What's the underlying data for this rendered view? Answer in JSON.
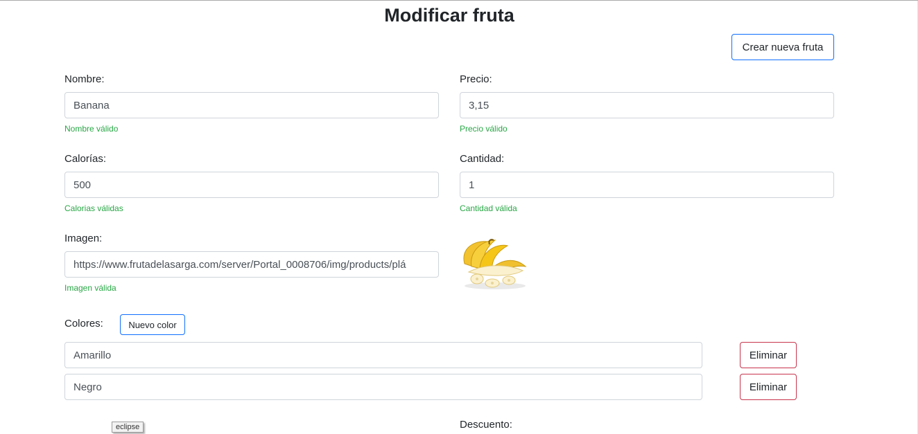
{
  "page": {
    "title": "Modificar fruta"
  },
  "toolbar": {
    "create_label": "Crear nueva fruta"
  },
  "form": {
    "nombre": {
      "label": "Nombre:",
      "value": "Banana",
      "feedback": "Nombre válido"
    },
    "precio": {
      "label": "Precio:",
      "value": "3,15",
      "feedback": "Precio válido"
    },
    "calorias": {
      "label": "Calorías:",
      "value": "500",
      "feedback": "Calorias válidas"
    },
    "cantidad": {
      "label": "Cantidad:",
      "value": "1",
      "feedback": "Cantidad válida"
    },
    "imagen": {
      "label": "Imagen:",
      "value": "https://www.frutadelasarga.com/server/Portal_0008706/img/products/plá",
      "feedback": "Imagen válida"
    },
    "colores": {
      "label": "Colores:",
      "add_label": "Nuevo color",
      "items": [
        {
          "value": "Amarillo",
          "remove_label": "Eliminar"
        },
        {
          "value": "Negro",
          "remove_label": "Eliminar"
        }
      ]
    },
    "descuento": {
      "label": "Descuento:"
    }
  },
  "tooltip": {
    "text": "eclipse"
  },
  "colors": {
    "primary": "#0d6efd",
    "danger": "#c7324b",
    "valid": "#28a745",
    "banana": "#f5c518"
  }
}
